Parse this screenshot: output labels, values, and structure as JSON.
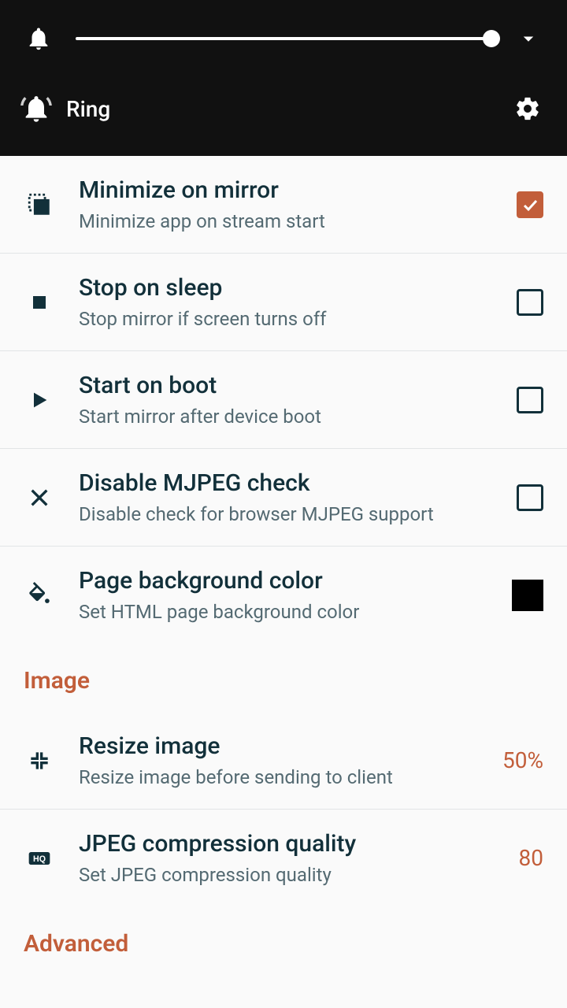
{
  "topbar": {
    "ring_label": "Ring",
    "volume_percent": 100
  },
  "settings": [
    {
      "title": "Minimize on mirror",
      "subtitle": "Minimize app on stream start",
      "type": "checkbox",
      "checked": true,
      "icon": "minimize"
    },
    {
      "title": "Stop on sleep",
      "subtitle": "Stop mirror if screen turns off",
      "type": "checkbox",
      "checked": false,
      "icon": "stop"
    },
    {
      "title": "Start on boot",
      "subtitle": "Start mirror after device boot",
      "type": "checkbox",
      "checked": false,
      "icon": "play"
    },
    {
      "title": "Disable MJPEG check",
      "subtitle": "Disable check for browser MJPEG support",
      "type": "checkbox",
      "checked": false,
      "icon": "cross"
    },
    {
      "title": "Page background color",
      "subtitle": "Set HTML page background color",
      "type": "color",
      "color": "#000000",
      "icon": "paint"
    }
  ],
  "image_section": {
    "header": "Image",
    "items": [
      {
        "title": "Resize image",
        "subtitle": "Resize image before sending to client",
        "type": "value",
        "value": "50%",
        "icon": "compress"
      },
      {
        "title": "JPEG compression quality",
        "subtitle": "Set JPEG compression quality",
        "type": "value",
        "value": "80",
        "icon": "hq"
      }
    ]
  },
  "advanced_section": {
    "header": "Advanced"
  }
}
